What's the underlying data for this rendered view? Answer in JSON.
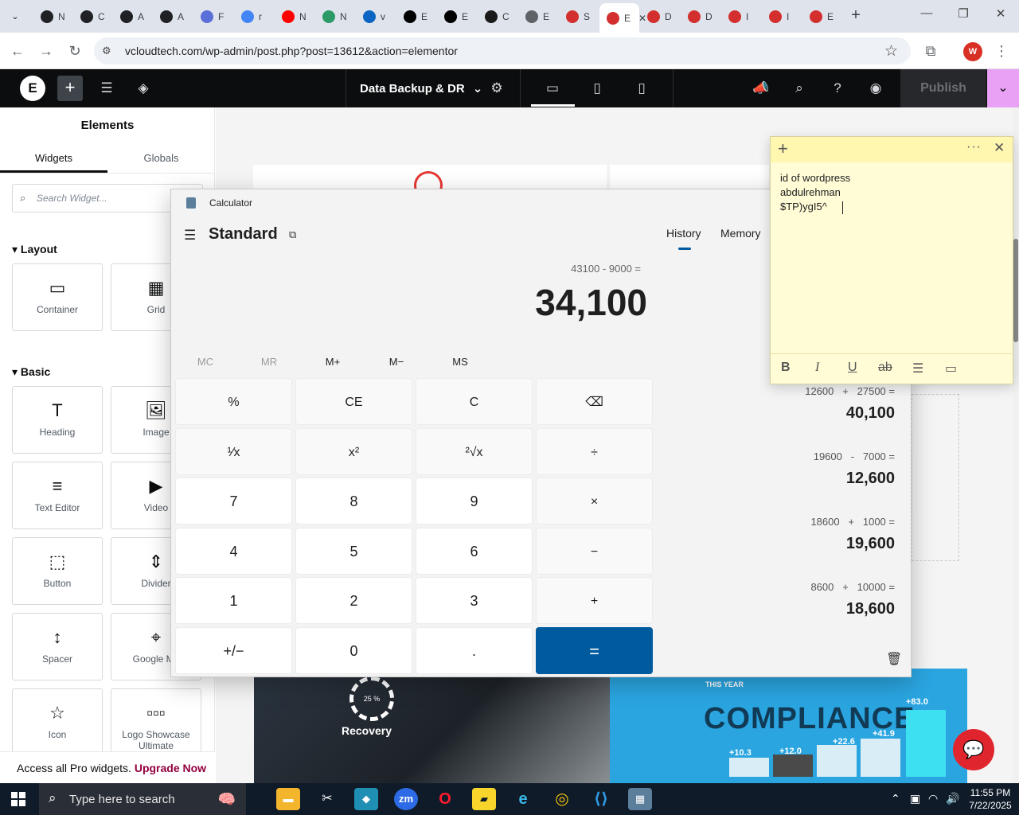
{
  "browser": {
    "tabs": [
      {
        "icon": "openai-icon",
        "label": "N",
        "color": "#202124"
      },
      {
        "icon": "openai-icon",
        "label": "C",
        "color": "#202124"
      },
      {
        "icon": "openai-icon",
        "label": "A",
        "color": "#202124"
      },
      {
        "icon": "openai-icon",
        "label": "A",
        "color": "#202124"
      },
      {
        "icon": "wp-icon",
        "label": "F",
        "color": "#5b6fd8"
      },
      {
        "icon": "google-icon",
        "label": "r",
        "color": "#4285f4"
      },
      {
        "icon": "youtube-icon",
        "label": "N",
        "color": "#ff0000"
      },
      {
        "icon": "w-icon",
        "label": "N",
        "color": "#2b9a66"
      },
      {
        "icon": "linkedin-icon",
        "label": "v",
        "color": "#0a66c2"
      },
      {
        "icon": "x-icon",
        "label": "E",
        "color": "#000000"
      },
      {
        "icon": "x-icon",
        "label": "E",
        "color": "#000000"
      },
      {
        "icon": "slack-icon",
        "label": "C",
        "color": "#1a1a1a"
      },
      {
        "icon": "globe-icon",
        "label": "E",
        "color": "#5f6368"
      },
      {
        "icon": "elementor-icon",
        "label": "S",
        "color": "#d32f2f"
      },
      {
        "icon": "elementor-icon",
        "label": "E",
        "color": "#d32f2f"
      },
      {
        "icon": "elementor-icon",
        "label": "D",
        "color": "#d32f2f"
      },
      {
        "icon": "elementor-icon",
        "label": "D",
        "color": "#d32f2f"
      },
      {
        "icon": "elementor-icon",
        "label": "I",
        "color": "#d32f2f"
      },
      {
        "icon": "elementor-icon",
        "label": "I",
        "color": "#d32f2f"
      },
      {
        "icon": "elementor-icon",
        "label": "E",
        "color": "#d32f2f"
      }
    ],
    "active_tab_index": 14,
    "url": "vcloudtech.com/wp-admin/post.php?post=13612&action=elementor",
    "profile_initial": "W"
  },
  "editor": {
    "doc_title": "Data Backup & DR",
    "publish_label": "Publish",
    "accent_color": "#e8a1f5"
  },
  "panel": {
    "title": "Elements",
    "tabs": [
      "Widgets",
      "Globals"
    ],
    "search_placeholder": "Search Widget...",
    "sections": [
      {
        "title": "Layout",
        "widgets": [
          {
            "label": "Container",
            "icon": "container-icon"
          },
          {
            "label": "Grid",
            "icon": "grid-icon"
          }
        ]
      },
      {
        "title": "Basic",
        "widgets": [
          {
            "label": "Heading",
            "icon": "heading-icon"
          },
          {
            "label": "Image",
            "icon": "image-icon"
          },
          {
            "label": "Text Editor",
            "icon": "text-editor-icon"
          },
          {
            "label": "Video",
            "icon": "video-icon"
          },
          {
            "label": "Button",
            "icon": "button-icon"
          },
          {
            "label": "Divider",
            "icon": "divider-icon"
          },
          {
            "label": "Spacer",
            "icon": "spacer-icon"
          },
          {
            "label": "Google Ma",
            "icon": "map-icon"
          },
          {
            "label": "Icon",
            "icon": "star-icon"
          },
          {
            "label": "Logo Showcase Ultimate",
            "icon": "logo-showcase-icon"
          }
        ]
      }
    ],
    "promo_text": "Access all Pro widgets.",
    "promo_link": "Upgrade Now"
  },
  "canvas": {
    "image1_text": "Recovery",
    "image1_percent": "25 %",
    "image2_caption": "THIS YEAR",
    "image2_title": "COMPLIANCE",
    "image2_values": [
      "+83.0",
      "+22.6",
      "+41.9",
      "+10.3",
      "+12.0"
    ]
  },
  "calculator": {
    "window_title": "Calculator",
    "mode": "Standard",
    "expression": "43100 - 9000 =",
    "result": "34,100",
    "memory_buttons": [
      "MC",
      "MR",
      "M+",
      "M−",
      "MS"
    ],
    "keys": [
      [
        "%",
        "CE",
        "C",
        "⌫"
      ],
      [
        "¹⁄x",
        "x²",
        "²√x",
        "÷"
      ],
      [
        "7",
        "8",
        "9",
        "×"
      ],
      [
        "4",
        "5",
        "6",
        "−"
      ],
      [
        "1",
        "2",
        "3",
        "+"
      ],
      [
        "+/−",
        "0",
        ".",
        "="
      ]
    ],
    "history_tab": "History",
    "memory_tab": "Memory",
    "history": [
      {
        "expr": "12600   +   27500 =",
        "result": "40,100"
      },
      {
        "expr": "19600   -   7000 =",
        "result": "12,600"
      },
      {
        "expr": "18600   +   1000 =",
        "result": "19,600"
      },
      {
        "expr": "8600   +   10000 =",
        "result": "18,600"
      }
    ]
  },
  "sticky": {
    "lines": [
      "id of wordpress",
      "abdulrehman",
      "$TP)ygI5^"
    ],
    "bg_color": "#fffcd6"
  },
  "taskbar": {
    "search_placeholder": "Type here to search",
    "time": "11:55 PM",
    "date": "7/22/2025"
  }
}
